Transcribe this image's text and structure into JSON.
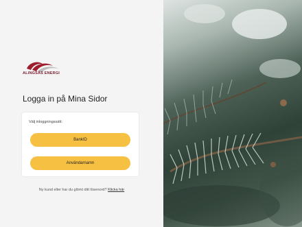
{
  "brand": {
    "logo_text": "ALINGSÅS ENERGI",
    "colors": {
      "logo_red": "#9d1f2f",
      "accent_yellow": "#f6c043"
    }
  },
  "login": {
    "title": "Logga in på Mina Sidor",
    "choose_method_label": "Välj inloggningssätt:",
    "bankid_button": "BankID",
    "username_button": "Användarnamn",
    "help_text": "Ny kund eller har du glömt ditt lösenord?",
    "help_link": "Klicka här"
  },
  "hero": {
    "image_icon": "pine-branch-image"
  }
}
